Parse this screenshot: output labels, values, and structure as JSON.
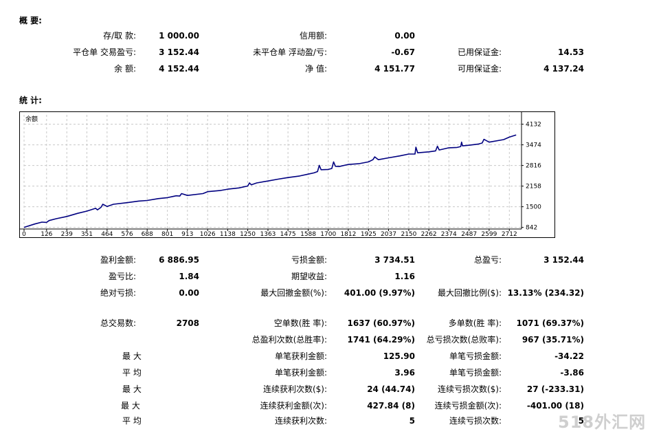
{
  "summary": {
    "title": "概 要:",
    "rows": [
      {
        "c1_label": "存/取 款:",
        "c1_value": "1 000.00",
        "c2_label": "信用额:",
        "c2_value": "0.00",
        "c3_label": "",
        "c3_value": ""
      },
      {
        "c1_label": "平仓单 交易盈亏:",
        "c1_value": "3 152.44",
        "c2_label": "未平仓单 浮动盈/亏:",
        "c2_value": "-0.67",
        "c3_label": "已用保证金:",
        "c3_value": "14.53"
      },
      {
        "c1_label": "余 额:",
        "c1_value": "4 152.44",
        "c2_label": "净 值:",
        "c2_value": "4 151.77",
        "c3_label": "可用保证金:",
        "c3_value": "4 137.24"
      }
    ]
  },
  "stats": {
    "title": "统 计:",
    "row_profit": {
      "gross_profit_label": "盈利金额:",
      "gross_profit": "6 886.95",
      "gross_loss_label": "亏损金额:",
      "gross_loss": "3 734.51",
      "total_profit_label": "总盈亏:",
      "total_profit": "3 152.44"
    },
    "row_factor": {
      "profit_factor_label": "盈亏比:",
      "profit_factor": "1.84",
      "expected_payoff_label": "期望收益:",
      "expected_payoff": "1.16"
    },
    "row_drawdown": {
      "abs_dd_label": "绝对亏损:",
      "abs_dd": "0.00",
      "max_dd_label": "最大回撤金额(%):",
      "max_dd": "401.00 (9.97%)",
      "max_dd_pct_label": "最大回撤比例($):",
      "max_dd_pct": "13.13% (234.32)"
    },
    "row_trades": {
      "total_trades_label": "总交易数:",
      "total_trades": "2708",
      "short_label": "空单数(胜 率):",
      "short_value": "1637 (60.97%)",
      "long_label": "多单数(胜 率):",
      "long_value": "1071 (69.37%)"
    },
    "row_winloss": {
      "win_label": "总盈利次数(总胜率):",
      "win_value": "1741 (64.29%)",
      "loss_label": "总亏损次数(总败率):",
      "loss_value": "967 (35.71%)"
    },
    "detail_rows": [
      {
        "left": "最 大",
        "l1": "单笔获利金额:",
        "v1": "125.90",
        "l2": "单笔亏损金额:",
        "v2": "-34.22"
      },
      {
        "left": "平 均",
        "l1": "单笔获利金额:",
        "v1": "3.96",
        "l2": "单笔亏损金额:",
        "v2": "-3.86"
      },
      {
        "left": "最 大",
        "l1": "连续获利次数($):",
        "v1": "24 (44.74)",
        "l2": "连续亏损次数($):",
        "v2": "27 (-233.31)"
      },
      {
        "left": "最 大",
        "l1": "连续获利金额(次):",
        "v1": "427.84 (8)",
        "l2": "连续亏损金额(次):",
        "v2": "-401.00 (18)"
      },
      {
        "left": "平 均",
        "l1": "连续获利次数:",
        "v1": "5",
        "l2": "连续亏损次数:",
        "v2": "5"
      }
    ]
  },
  "chart_data": {
    "type": "line",
    "title": "余额",
    "x_ticks": [
      0,
      126,
      239,
      351,
      464,
      576,
      688,
      801,
      913,
      1026,
      1138,
      1250,
      1363,
      1475,
      1588,
      1700,
      1812,
      1925,
      2037,
      2150,
      2262,
      2374,
      2487,
      2599,
      2712
    ],
    "y_ticks": [
      842,
      1500,
      2158,
      2816,
      3474,
      4132
    ],
    "xlim": [
      0,
      2780
    ],
    "ylim": [
      790,
      4430
    ],
    "line_color": "#000080",
    "grid": true,
    "series": [
      {
        "x": [
          0,
          60,
          100,
          126,
          140,
          180,
          239,
          300,
          351,
          400,
          410,
          430,
          440,
          464,
          500,
          576,
          640,
          688,
          750,
          801,
          850,
          870,
          880,
          913,
          1000,
          1026,
          1100,
          1138,
          1200,
          1250,
          1260,
          1270,
          1300,
          1363,
          1420,
          1475,
          1540,
          1588,
          1620,
          1640,
          1650,
          1660,
          1700,
          1720,
          1730,
          1740,
          1760,
          1812,
          1870,
          1925,
          1950,
          1960,
          1980,
          2037,
          2100,
          2150,
          2185,
          2190,
          2200,
          2262,
          2300,
          2310,
          2320,
          2374,
          2420,
          2440,
          2445,
          2450,
          2487,
          2540,
          2560,
          2570,
          2599,
          2680,
          2712,
          2750
        ],
        "y": [
          842,
          950,
          1010,
          1000,
          1060,
          1120,
          1190,
          1290,
          1360,
          1450,
          1400,
          1480,
          1580,
          1510,
          1580,
          1630,
          1680,
          1700,
          1760,
          1790,
          1850,
          1840,
          1920,
          1860,
          1920,
          1980,
          2020,
          2060,
          2100,
          2160,
          2260,
          2200,
          2260,
          2320,
          2380,
          2430,
          2480,
          2540,
          2580,
          2620,
          2820,
          2680,
          2690,
          2720,
          2930,
          2790,
          2780,
          2850,
          2870,
          2930,
          3000,
          3090,
          3000,
          3060,
          3120,
          3180,
          3180,
          3400,
          3220,
          3250,
          3280,
          3430,
          3310,
          3380,
          3390,
          3420,
          3560,
          3440,
          3460,
          3500,
          3530,
          3650,
          3560,
          3640,
          3720,
          3790
        ]
      }
    ]
  },
  "watermark": "518外汇网"
}
